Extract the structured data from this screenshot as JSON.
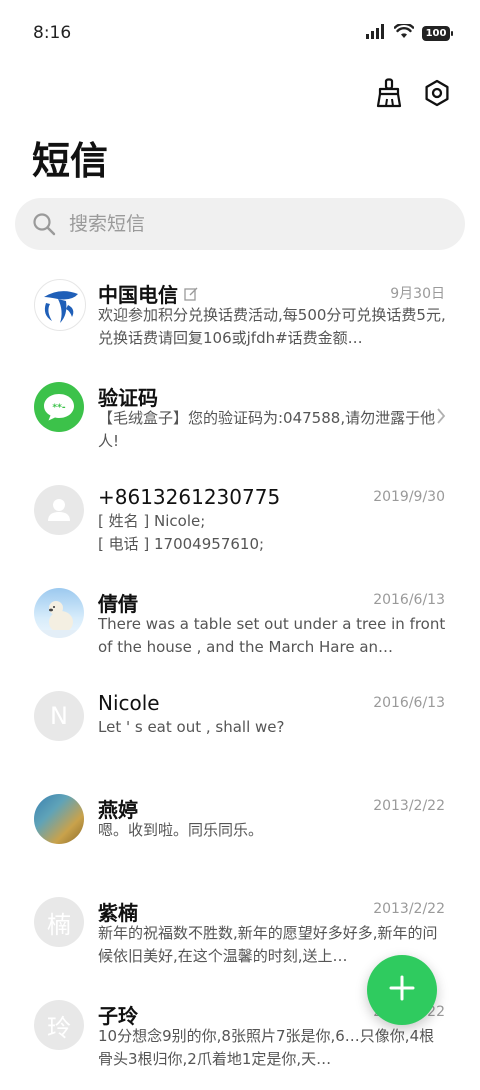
{
  "status_bar": {
    "time": "8:16",
    "battery": "100"
  },
  "header": {
    "title": "短信"
  },
  "search": {
    "placeholder": "搜索短信"
  },
  "threads": [
    {
      "name": "中国电信",
      "time": "9月30日",
      "preview": "欢迎参加积分兑换话费活动,每500分可兑换话费5元,兑换话费请回复106或jfdh#话费金额…"
    },
    {
      "name": "验证码",
      "time": "",
      "preview": "【毛绒盒子】您的验证码为:047588,请勿泄露于他人!"
    },
    {
      "name": "+8613261230775",
      "time": "2019/9/30",
      "preview": "[ 姓名 ] Nicole;\n[ 电话 ] 17004957610;"
    },
    {
      "name": "倩倩",
      "time": "2016/6/13",
      "preview": "There was a table set out under a tree in front of the house , and the March Hare an…"
    },
    {
      "name": "Nicole",
      "time": "2016/6/13",
      "preview": "Let ' s eat out , shall we?",
      "initial": "N"
    },
    {
      "name": "燕婷",
      "time": "2013/2/22",
      "preview": "嗯。收到啦。同乐同乐。"
    },
    {
      "name": "紫楠",
      "time": "2013/2/22",
      "preview": "新年的祝福数不胜数,新年的愿望好多好多,新年的问候依旧美好,在这个温馨的时刻,送上…",
      "initial": "楠"
    },
    {
      "name": "子玲",
      "time": "2013/2/22",
      "preview": "10分想念9别的你,8张照片7张是你,6…只像你,4根骨头3根归你,2爪着地1定是你,天…",
      "initial": "玲"
    }
  ],
  "colors": {
    "accent": "#2fcb5f",
    "telecom_blue": "#1f5fb8",
    "muted": "#9a9a9a"
  }
}
